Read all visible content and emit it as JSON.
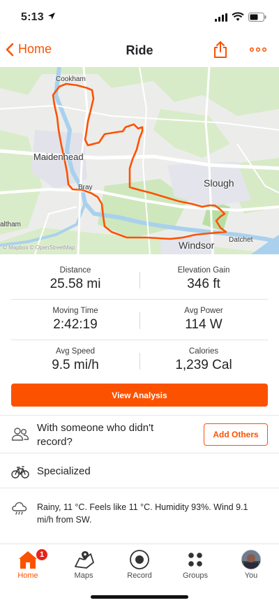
{
  "status_bar": {
    "time": "5:13"
  },
  "nav": {
    "back_label": "Home",
    "title": "Ride"
  },
  "map": {
    "labels": {
      "cookham": "Cookham",
      "maidenhead": "Maidenhead",
      "bray": "Bray",
      "slough": "Slough",
      "windsor": "Windsor",
      "datchet": "Datchet",
      "waltham": "altham",
      "attribution": "© Mapbox © OpenStreetMap"
    },
    "route_color": "#fc5200"
  },
  "stats": {
    "distance": {
      "label": "Distance",
      "value": "25.58 mi"
    },
    "elevation_gain": {
      "label": "Elevation Gain",
      "value": "346 ft"
    },
    "moving_time": {
      "label": "Moving Time",
      "value": "2:42:19"
    },
    "avg_power": {
      "label": "Avg Power",
      "value": "114 W"
    },
    "avg_speed": {
      "label": "Avg Speed",
      "value": "9.5 mi/h"
    },
    "calories": {
      "label": "Calories",
      "value": "1,239 Cal"
    }
  },
  "view_analysis_label": "View Analysis",
  "others": {
    "text": "With someone who didn't record?",
    "button_label": "Add Others"
  },
  "gear": {
    "name": "Specialized"
  },
  "weather": {
    "text": "Rainy, 11 °C. Feels like 11 °C. Humidity 93%. Wind 9.1 mi/h from SW."
  },
  "tabs": [
    {
      "label": "Home",
      "icon": "home-icon",
      "badge": "1",
      "active": true
    },
    {
      "label": "Maps",
      "icon": "maps-icon"
    },
    {
      "label": "Record",
      "icon": "record-icon"
    },
    {
      "label": "Groups",
      "icon": "groups-icon"
    },
    {
      "label": "You",
      "icon": "avatar"
    }
  ],
  "colors": {
    "accent": "#fc5200",
    "badge": "#e8231a"
  }
}
